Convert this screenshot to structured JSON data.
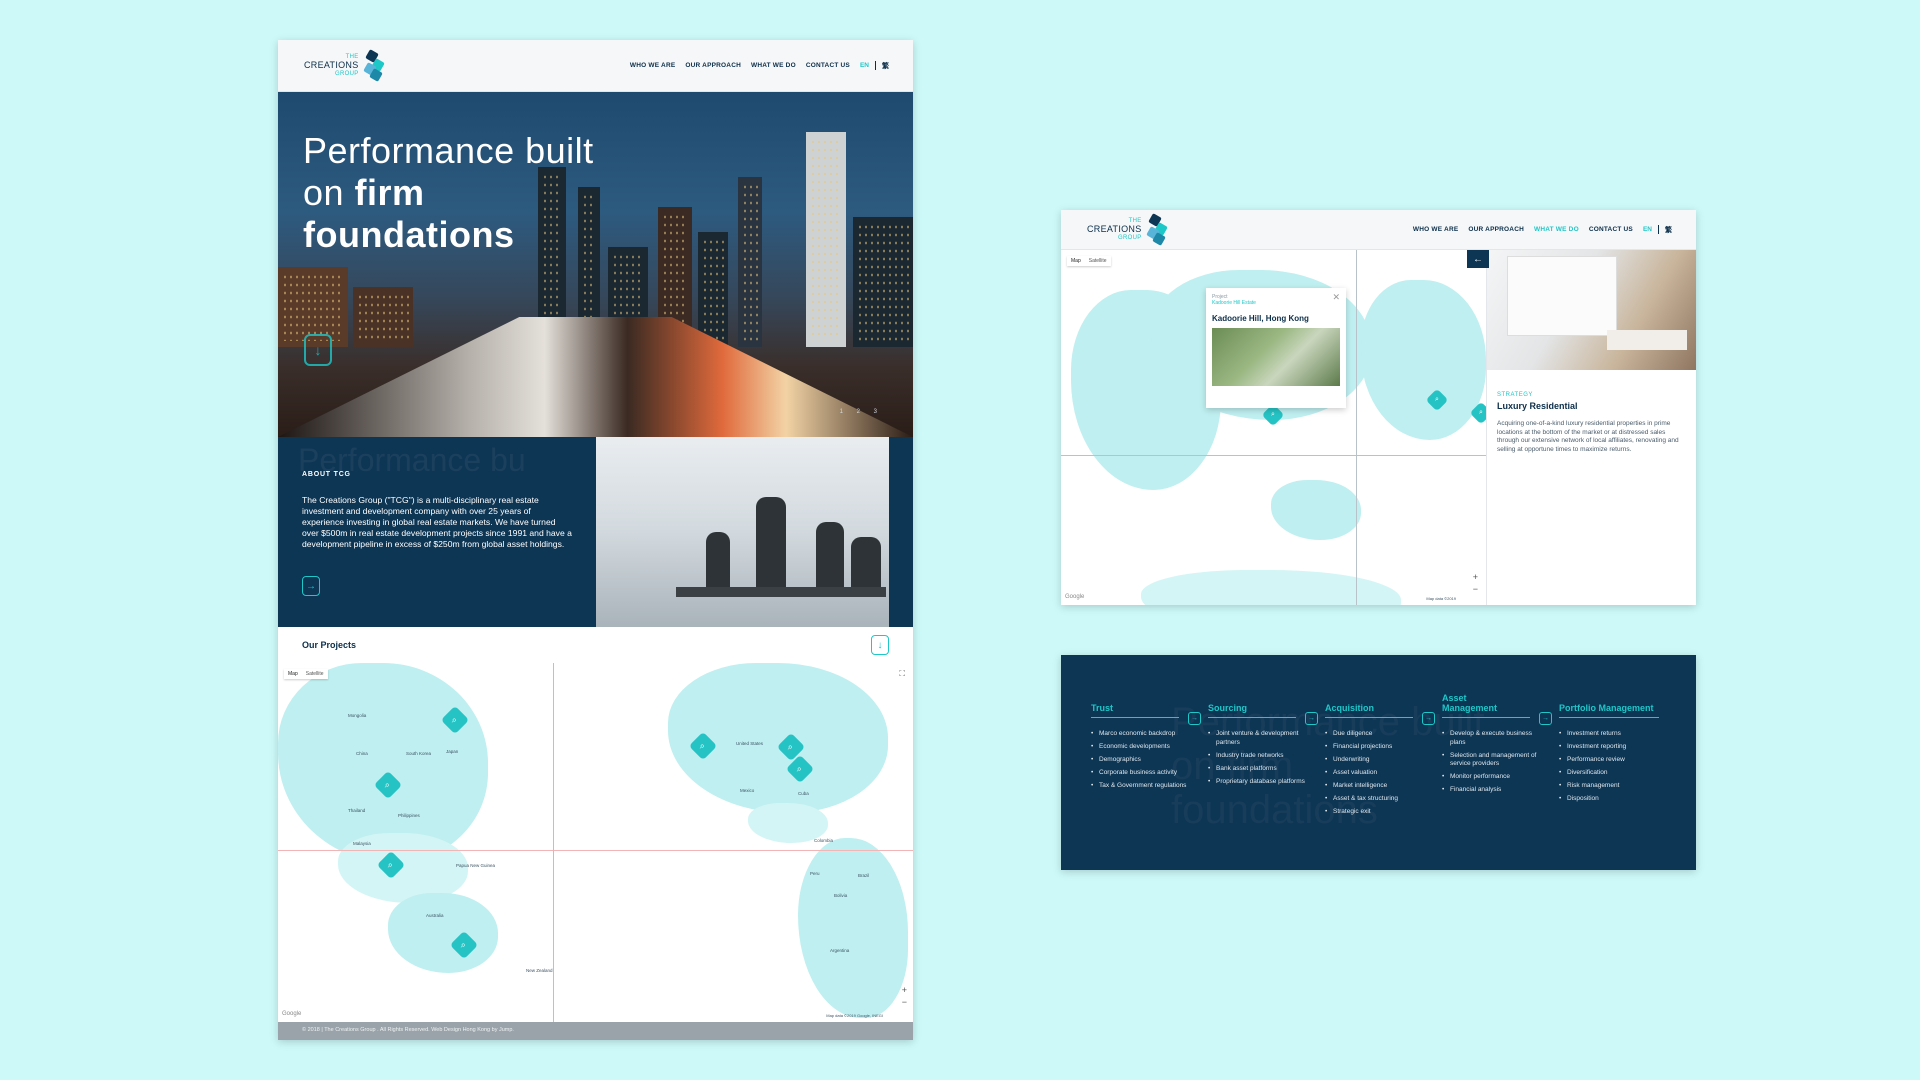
{
  "logo": {
    "the": "THE",
    "creations": "CREATIONS",
    "group": "GROUP"
  },
  "nav": {
    "items": [
      "WHO WE ARE",
      "OUR APPROACH",
      "WHAT WE DO",
      "CONTACT US"
    ],
    "lang": "EN",
    "lang_alt": "繁"
  },
  "hero": {
    "title_line1": "Performance built",
    "title_line2_prefix": "on ",
    "title_line2_bold": "firm",
    "title_line3_bold": "foundations",
    "slides": "1  2  3"
  },
  "about": {
    "bg_text": "Performance bu",
    "label": "ABOUT TCG",
    "text": "The Creations Group (\"TCG\") is a multi-disciplinary real estate investment and development company with over 25 years of experience investing in global real estate markets. We have turned over $500m in real estate development projects since 1991 and have a development pipeline in excess of $250m from global asset holdings."
  },
  "projects": {
    "title": "Our Projects"
  },
  "map": {
    "tabs": [
      "Map",
      "Satellite"
    ],
    "labels": [
      "Mongolia",
      "China",
      "South Korea",
      "Japan",
      "Thailand",
      "Philippines",
      "Malaysia",
      "Papua New Guinea",
      "Australia",
      "New Zealand",
      "United States",
      "Mexico",
      "Cuba",
      "Colombia",
      "Peru",
      "Brazil",
      "Bolivia",
      "Argentina"
    ],
    "zoom_in": "+",
    "zoom_out": "−",
    "credit": "Map data ©2019 Google, INEGI",
    "google": "Google"
  },
  "footer": {
    "text": "© 2018 | The Creations Group . All Rights Reserved. Web Design Hong Kong by Jump."
  },
  "map_detail": {
    "popup_small": "Project",
    "popup_link": "Kadoorie Hill Estate",
    "popup_title": "Kadoorie Hill, Hong Kong",
    "back": "←",
    "close": "✕",
    "strategy_label": "STRATEGY",
    "strategy_title": "Luxury Residential",
    "strategy_text": "Acquiring one-of-a-kind luxury residential properties in prime locations at the bottom of the market or at distressed sales through our extensive network of local affiliates, renovating and selling at opportune times to maximize returns.",
    "credit": "Map data ©2019",
    "google": "Google"
  },
  "process": {
    "bg_text": "Performance built on firm foundations",
    "columns": [
      {
        "title": "Trust",
        "items": [
          "Marco economic backdrop",
          "Economic developments",
          "Demographics",
          "Corporate business activity",
          "Tax & Government regulations"
        ]
      },
      {
        "title": "Sourcing",
        "items": [
          "Joint venture & development partners",
          "Industry trade networks",
          "Bank asset platforms",
          "Proprietary database platforms"
        ]
      },
      {
        "title": "Acquisition",
        "items": [
          "Due diligence",
          "Financial projections",
          "Underwriting",
          "Asset valuation",
          "Market intelligence",
          "Asset & tax structuring",
          "Strategic exit"
        ]
      },
      {
        "title": "Asset Management",
        "items": [
          "Develop & execute business plans",
          "Selection and management of service providers",
          "Monitor performance",
          "Financial analysis"
        ]
      },
      {
        "title": "Portfolio Management",
        "items": [
          "Investment returns",
          "Investment reporting",
          "Performance review",
          "Diversification",
          "Risk management",
          "Disposition"
        ]
      }
    ]
  },
  "colors": {
    "accent": "#1ec7c8",
    "navy": "#0d3554",
    "background": "#cdf9f9"
  }
}
